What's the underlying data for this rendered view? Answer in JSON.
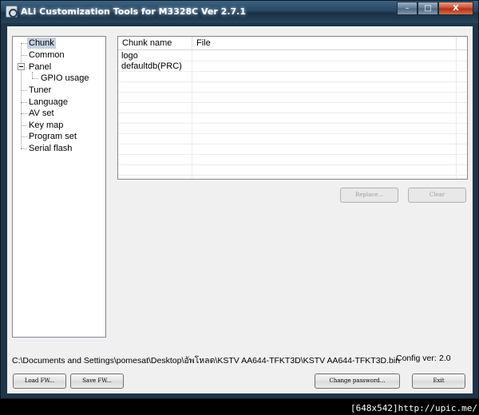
{
  "window": {
    "title": "ALi Customization Tools for M3328C  Ver 2.7.1",
    "controls": {
      "minimize": "–",
      "maximize": "□",
      "close": "X"
    }
  },
  "tree": {
    "items": [
      {
        "label": "Chunk",
        "selected": true
      },
      {
        "label": "Common"
      },
      {
        "label": "Panel",
        "expanded": true
      },
      {
        "label": "GPIO usage",
        "child": true
      },
      {
        "label": "Tuner"
      },
      {
        "label": "Language"
      },
      {
        "label": "AV set"
      },
      {
        "label": "Key map"
      },
      {
        "label": "Program set"
      },
      {
        "label": "Serial flash"
      }
    ]
  },
  "chunk_list": {
    "columns": [
      "Chunk name",
      "File"
    ],
    "rows": [
      {
        "name": "logo",
        "file": ""
      },
      {
        "name": "defaultdb(PRC)",
        "file": ""
      }
    ]
  },
  "buttons": {
    "replace": "Replace...",
    "clear": "Clear",
    "load_fw": "Load FW...",
    "save_fw": "Save FW...",
    "change_password": "Change password...",
    "exit": "Exit"
  },
  "status": {
    "path": "C:\\Documents and Settings\\pomesat\\Desktop\\อัพโหลด\\KSTV AA644-TFKT3D\\KSTV AA644-TFKT3D.bin",
    "config_label": "Config ver:",
    "config_value": "2.0"
  },
  "overlay": {
    "size_tag": "[648x542]http://upic.me/"
  }
}
